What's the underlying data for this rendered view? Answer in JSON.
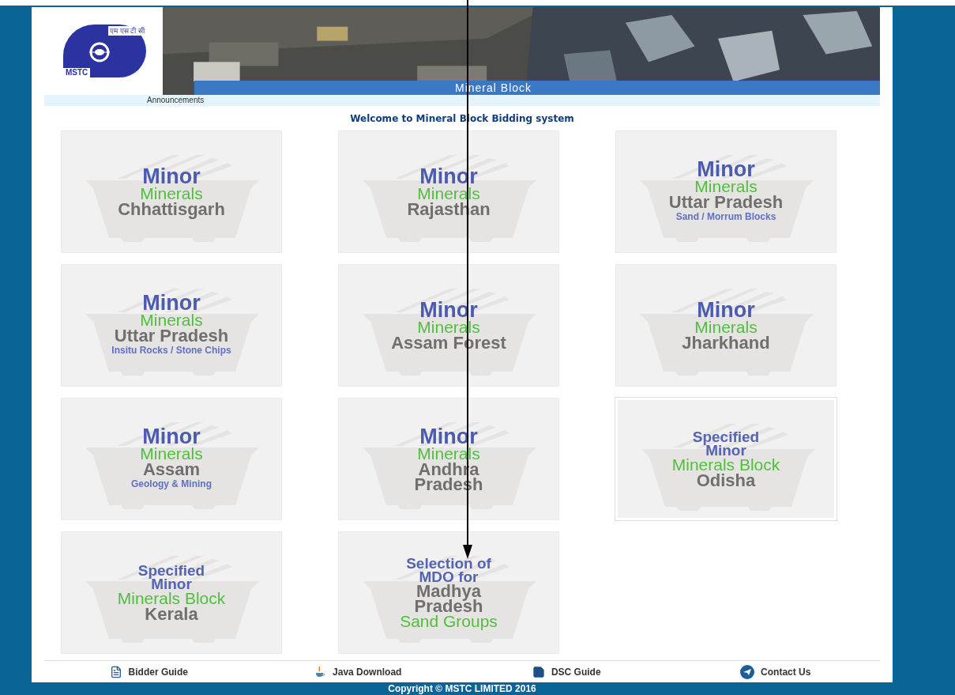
{
  "header": {
    "logo": {
      "hindi": "एम एस टी सी",
      "abbr": "MSTC"
    },
    "banner_title": "Mineral Block",
    "announcements": "Announcements"
  },
  "welcome": "Welcome to Mineral Block Bidding system",
  "tiles": [
    {
      "framed": false,
      "lines": [
        {
          "kind": "title",
          "text": "Minor"
        },
        {
          "kind": "mineral",
          "text": "Minerals"
        },
        {
          "kind": "state",
          "text": "Chhattisgarh"
        }
      ]
    },
    {
      "framed": false,
      "lines": [
        {
          "kind": "title",
          "text": "Minor"
        },
        {
          "kind": "mineral",
          "text": "Minerals"
        },
        {
          "kind": "state",
          "text": "Rajasthan"
        }
      ]
    },
    {
      "framed": false,
      "lines": [
        {
          "kind": "title",
          "text": "Minor"
        },
        {
          "kind": "mineral",
          "text": "Minerals"
        },
        {
          "kind": "state",
          "text": "Uttar Pradesh"
        },
        {
          "kind": "note",
          "text": "Sand / Morrum Blocks"
        }
      ]
    },
    {
      "framed": false,
      "lines": [
        {
          "kind": "title",
          "text": "Minor"
        },
        {
          "kind": "mineral",
          "text": "Minerals"
        },
        {
          "kind": "state",
          "text": "Uttar Pradesh"
        },
        {
          "kind": "note",
          "text": "Insitu Rocks / Stone Chips"
        }
      ]
    },
    {
      "framed": false,
      "lines": [
        {
          "kind": "title",
          "text": "Minor"
        },
        {
          "kind": "mineral",
          "text": "Minerals"
        },
        {
          "kind": "state",
          "text": "Assam Forest"
        }
      ]
    },
    {
      "framed": false,
      "lines": [
        {
          "kind": "title",
          "text": "Minor"
        },
        {
          "kind": "mineral",
          "text": "Minerals"
        },
        {
          "kind": "state",
          "text": "Jharkhand"
        }
      ]
    },
    {
      "framed": false,
      "lines": [
        {
          "kind": "title",
          "text": "Minor"
        },
        {
          "kind": "mineral",
          "text": "Minerals"
        },
        {
          "kind": "state",
          "text": "Assam"
        },
        {
          "kind": "note",
          "text": "Geology & Mining"
        }
      ]
    },
    {
      "framed": false,
      "lines": [
        {
          "kind": "title",
          "text": "Minor"
        },
        {
          "kind": "mineral",
          "text": "Minerals"
        },
        {
          "kind": "state",
          "text": "Andhra"
        },
        {
          "kind": "state",
          "text": "Pradesh"
        }
      ]
    },
    {
      "framed": true,
      "lines": [
        {
          "kind": "heading",
          "text": "Specified"
        },
        {
          "kind": "heading",
          "text": "Minor"
        },
        {
          "kind": "mineral",
          "text": "Minerals Block"
        },
        {
          "kind": "state",
          "text": "Odisha"
        }
      ]
    },
    {
      "framed": false,
      "lines": [
        {
          "kind": "heading",
          "text": "Specified"
        },
        {
          "kind": "heading",
          "text": "Minor"
        },
        {
          "kind": "mineral",
          "text": "Minerals Block"
        },
        {
          "kind": "state",
          "text": "Kerala"
        }
      ]
    },
    {
      "framed": false,
      "lines": [
        {
          "kind": "heading",
          "text": "Selection of"
        },
        {
          "kind": "heading",
          "text": "MDO for"
        },
        {
          "kind": "state",
          "text": "Madhya"
        },
        {
          "kind": "state",
          "text": "Pradesh"
        },
        {
          "kind": "mineral",
          "text": "Sand Groups"
        }
      ]
    }
  ],
  "footer_links": [
    {
      "kind": "guide",
      "label": "Bidder Guide"
    },
    {
      "kind": "java",
      "label": "Java Download"
    },
    {
      "kind": "dsc",
      "label": "DSC Guide"
    },
    {
      "kind": "contact",
      "label": "Contact Us"
    }
  ],
  "copyright": "Copyright © MSTC LIMITED 2016"
}
